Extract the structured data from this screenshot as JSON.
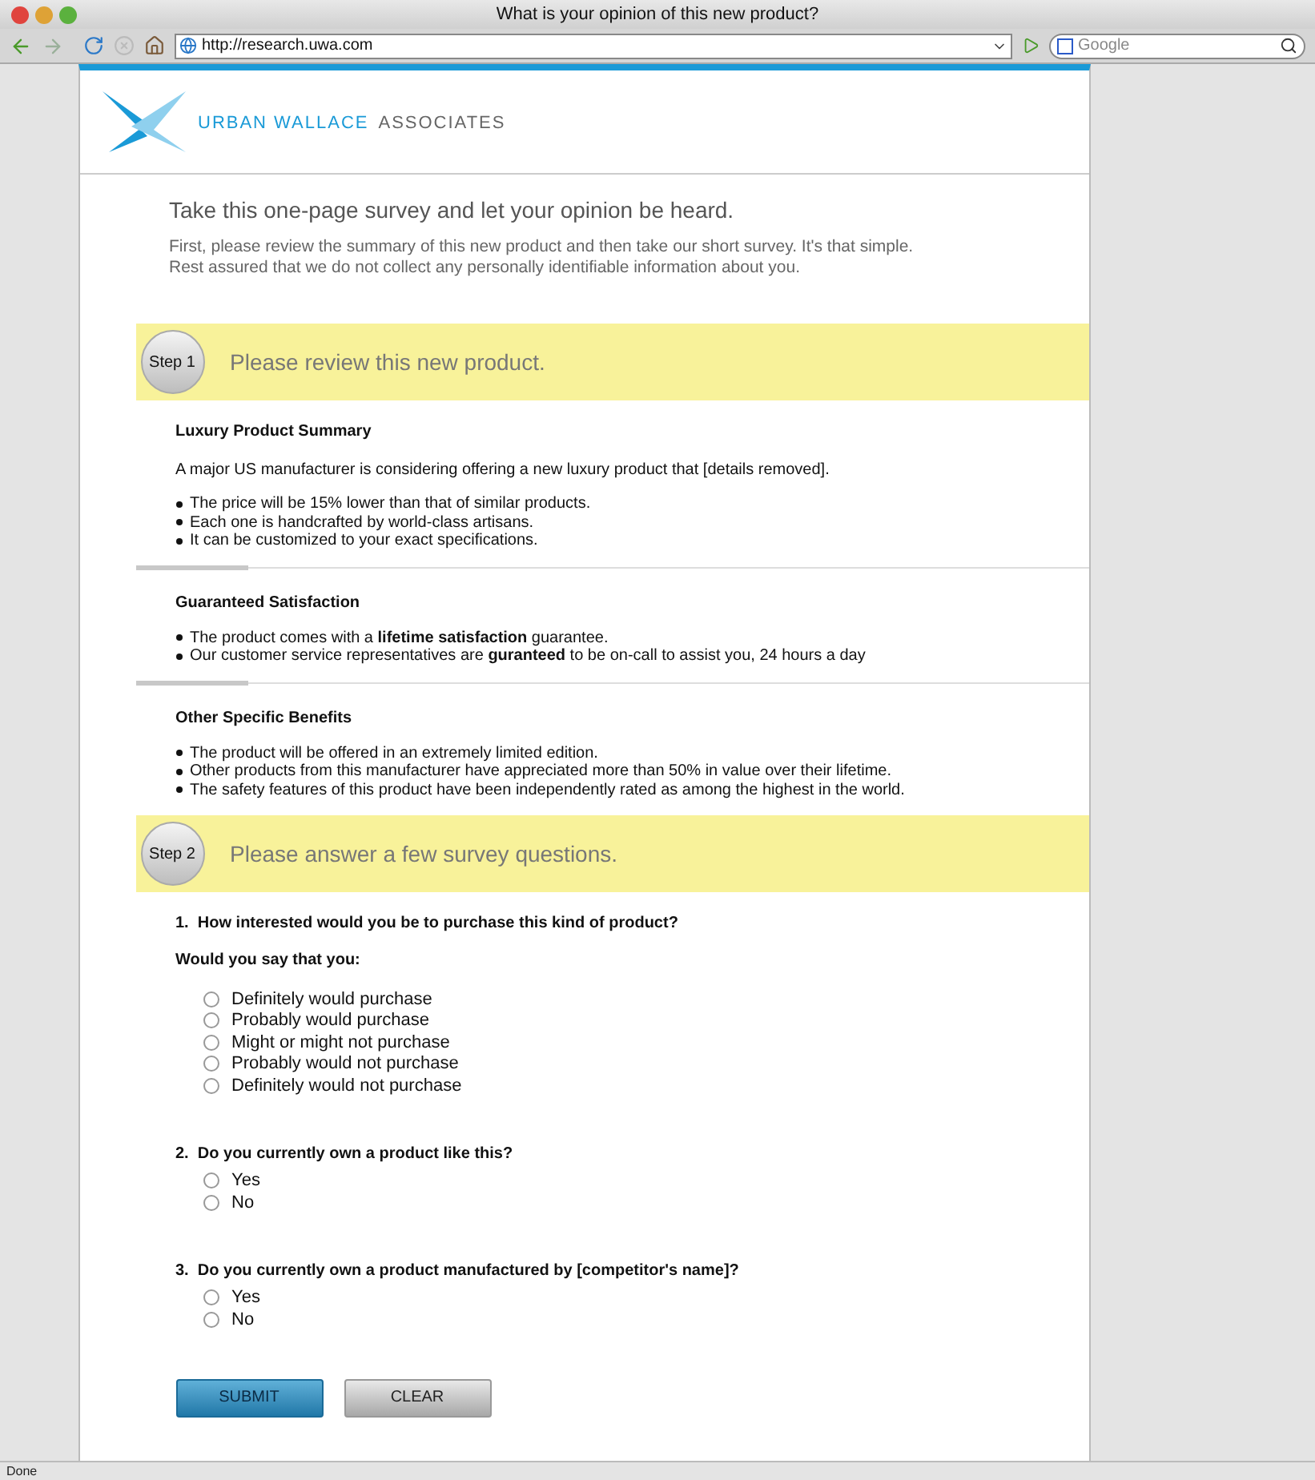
{
  "browser": {
    "title": "What is your opinion of this new product?",
    "url": "http://research.uwa.com",
    "search_placeholder": "Google",
    "status": "Done"
  },
  "brand": {
    "name_primary": "URBAN WALLACE",
    "name_secondary": "ASSOCIATES"
  },
  "intro": {
    "heading": "Take this one-page survey and let your opinion be heard.",
    "text": "First, please review the summary of this new product and then take our short survey. It's that simple. Rest assured that we do not collect any personally identifiable information about you."
  },
  "steps": [
    {
      "badge": "Step 1",
      "title": "Please review this new product.",
      "sections": [
        {
          "heading": "Luxury Product Summary",
          "paragraph": "A major US manufacturer is considering offering a new luxury product that [details removed].",
          "bullets": [
            "The price will be 15% lower than that of similar products.",
            "Each one is handcrafted by world-class artisans.",
            "It can be customized to your exact specifications."
          ]
        },
        {
          "heading": "Guaranteed Satisfaction",
          "bullets": [
            "The product comes with a **lifetime satisfaction** guarantee.",
            "Our customer service representatives are **guranteed** to be on-call to assist you, 24 hours a day"
          ]
        },
        {
          "heading": "Other Specific Benefits",
          "bullets": [
            "The product will be offered in an extremely limited edition.",
            "Other products from this manufacturer have appreciated more than 50% in value over their lifetime.",
            "The safety features of this product have been independently rated as among the highest in the world."
          ]
        }
      ]
    },
    {
      "badge": "Step 2",
      "title": "Please answer a few survey questions.",
      "questions": [
        {
          "number": "1.",
          "text": "How interested would you be to purchase this kind of product?",
          "prompt": "Would you say that you:",
          "options": [
            {
              "label": "Definitely would purchase",
              "selected": false
            },
            {
              "label": "Probably would purchase",
              "selected": false
            },
            {
              "label": "Might or might not purchase",
              "selected": false
            },
            {
              "label": "Probably would not purchase",
              "selected": false
            },
            {
              "label": "Definitely would not purchase",
              "selected": false
            }
          ]
        },
        {
          "number": "2.",
          "text": "Do you currently own a product like this?",
          "options": [
            {
              "label": "Yes",
              "selected": false
            },
            {
              "label": "No",
              "selected": false
            }
          ]
        },
        {
          "number": "3.",
          "text": "Do you currently own a product manufactured by [competitor's name]?",
          "options": [
            {
              "label": "Yes",
              "selected": false
            },
            {
              "label": "No",
              "selected": false
            }
          ]
        }
      ]
    }
  ],
  "buttons": [
    {
      "label": "SUBMIT",
      "kind": "primary"
    },
    {
      "label": "CLEAR",
      "kind": "secondary"
    }
  ]
}
